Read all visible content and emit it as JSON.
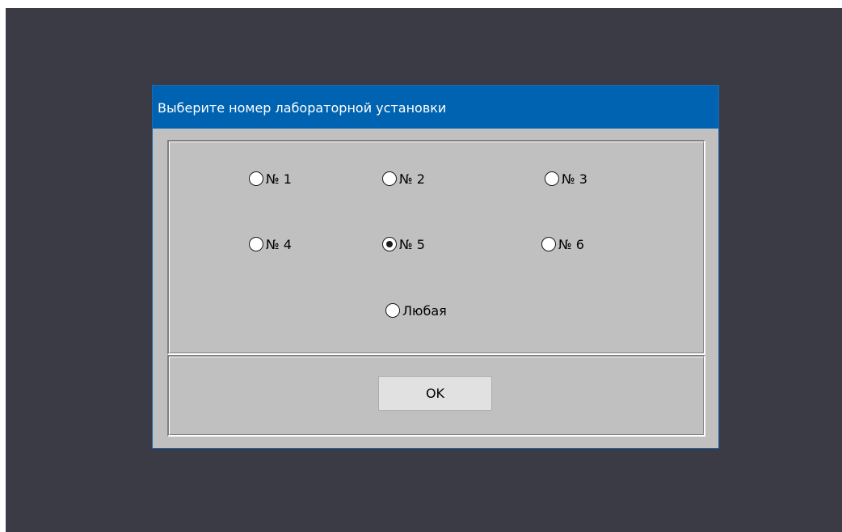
{
  "dialog": {
    "title": "Выберите номер лабораторной установки",
    "options": [
      {
        "label": "№ 1",
        "selected": false
      },
      {
        "label": "№ 2",
        "selected": false
      },
      {
        "label": "№ 3",
        "selected": false
      },
      {
        "label": "№ 4",
        "selected": false
      },
      {
        "label": "№ 5",
        "selected": true
      },
      {
        "label": "№ 6",
        "selected": false
      },
      {
        "label": "Любая",
        "selected": false
      }
    ],
    "ok_label": "OK"
  },
  "colors": {
    "desktop": "#3b3b45",
    "titlebar": "#0063b1",
    "dialog_face": "#c0c0c0",
    "button_face": "#e1e1e1"
  }
}
